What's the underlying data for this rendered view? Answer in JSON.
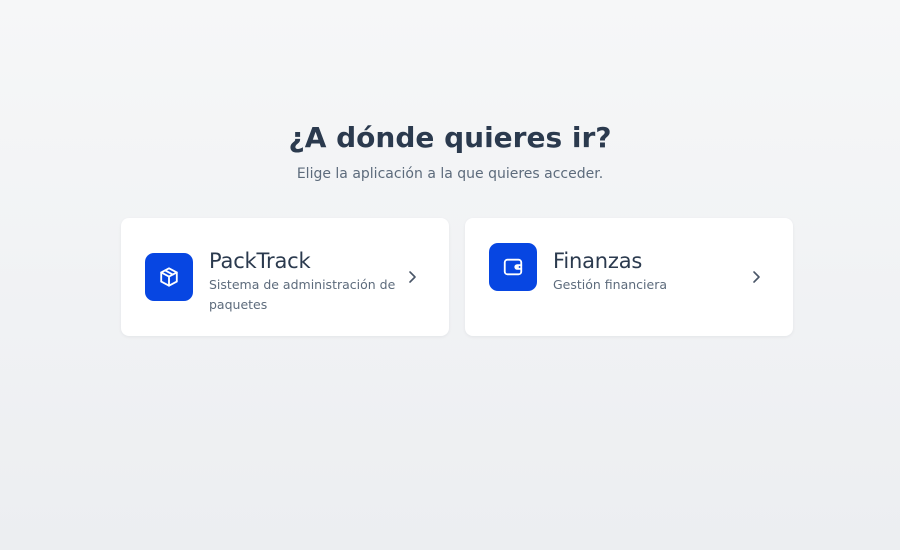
{
  "header": {
    "title": "¿A dónde quieres ir?",
    "subtitle": "Elige la aplicación a la que quieres acceder."
  },
  "apps": [
    {
      "name": "PackTrack",
      "description": "Sistema de administración de paquetes",
      "icon": "package-icon",
      "accent": "#0746e2"
    },
    {
      "name": "Finanzas",
      "description": "Gestión financiera",
      "icon": "wallet-icon",
      "accent": "#0746e2"
    }
  ],
  "colors": {
    "background": "#eef0f2",
    "card": "#ffffff",
    "title": "#2b3a4e",
    "muted": "#5d6b7c",
    "accent": "#0746e2"
  }
}
